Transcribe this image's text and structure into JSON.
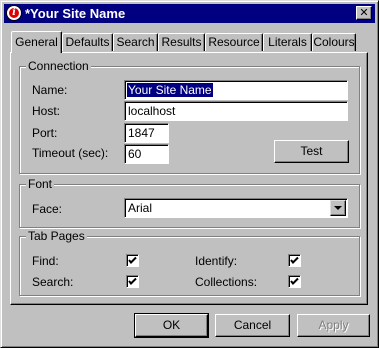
{
  "window": {
    "title": "*Your Site Name",
    "close_glyph": "✕"
  },
  "tabs": [
    "General",
    "Defaults",
    "Search",
    "Results",
    "Resource",
    "Literals",
    "Colours"
  ],
  "connection": {
    "group_label": "Connection",
    "name_label": "Name:",
    "name_value": "Your Site Name",
    "host_label": "Host:",
    "host_value": "localhost",
    "port_label": "Port:",
    "port_value": "1847",
    "timeout_label": "Timeout (sec):",
    "timeout_value": "60",
    "test_button": "Test"
  },
  "font": {
    "group_label": "Font",
    "face_label": "Face:",
    "face_value": "Arial"
  },
  "tab_pages": {
    "group_label": "Tab Pages",
    "find_label": "Find:",
    "find_checked": true,
    "search_label": "Search:",
    "search_checked": true,
    "identify_label": "Identify:",
    "identify_checked": true,
    "collections_label": "Collections:",
    "collections_checked": true
  },
  "buttons": {
    "ok": "OK",
    "cancel": "Cancel",
    "apply": "Apply"
  },
  "colors": {
    "titlebar": "#000080",
    "face": "#c0c0c0",
    "selection": "#000080"
  }
}
